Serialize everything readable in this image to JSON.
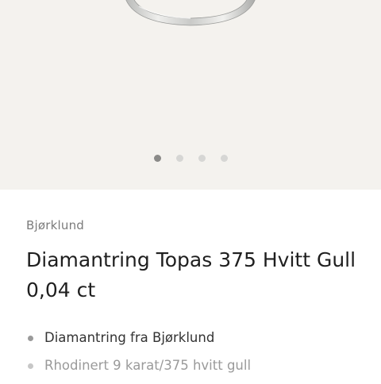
{
  "gallery": {
    "image": "ring-photo",
    "slide_count": 4,
    "active_slide": 1
  },
  "product": {
    "brand": "Bjørklund",
    "title": "Diamantring Topas 375 Hvitt Gull 0,04 ct",
    "features": [
      "Diamantring fra Bjørklund",
      "Rhodinert 9 karat/375 hvitt gull"
    ]
  },
  "colors": {
    "gallery_background": "#f4f2ee",
    "dot_active": "#8a8a88",
    "dot_inactive": "#d6d6d4",
    "title_text": "#1f1f1f",
    "brand_text": "#7b7b7b"
  }
}
